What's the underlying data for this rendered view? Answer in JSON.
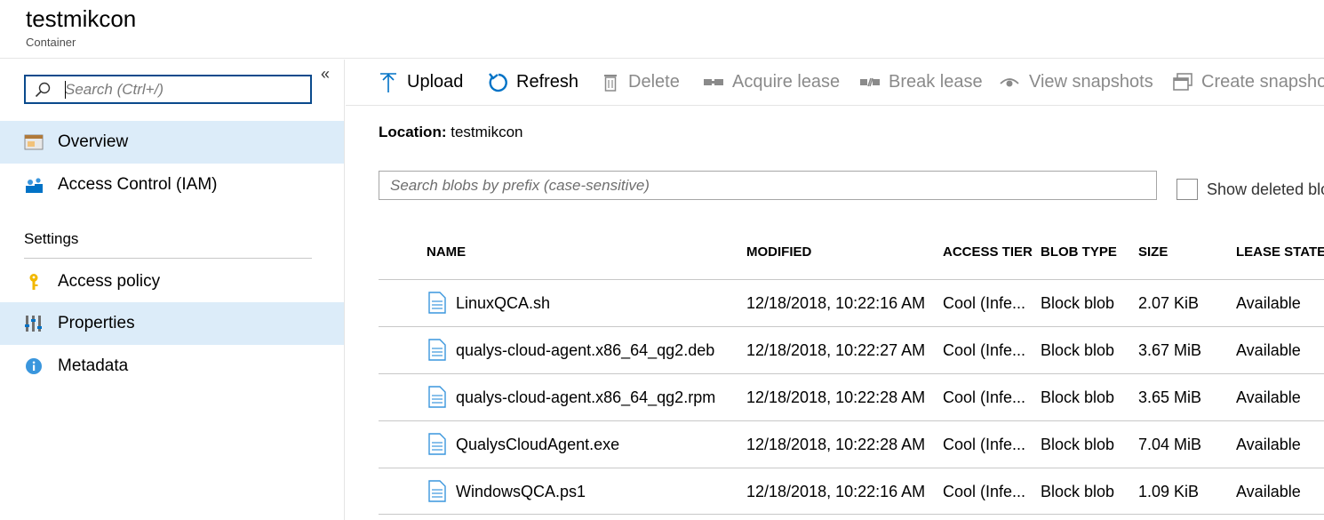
{
  "header": {
    "title": "testmikcon",
    "subtitle": "Container"
  },
  "sidebar": {
    "search_placeholder": "Search (Ctrl+/)",
    "collapse_glyph": "«",
    "items": [
      {
        "label": "Overview",
        "icon": "overview-icon",
        "active": true
      },
      {
        "label": "Access Control (IAM)",
        "icon": "iam-icon",
        "active": false
      }
    ],
    "settings_title": "Settings",
    "settings_items": [
      {
        "label": "Access policy",
        "icon": "key-icon",
        "active": false
      },
      {
        "label": "Properties",
        "icon": "properties-icon",
        "active": true
      },
      {
        "label": "Metadata",
        "icon": "info-icon",
        "active": false
      }
    ]
  },
  "toolbar": {
    "upload": "Upload",
    "refresh": "Refresh",
    "delete": "Delete",
    "acquire_lease": "Acquire lease",
    "break_lease": "Break lease",
    "view_snapshots": "View snapshots",
    "create_snapshot": "Create snapshot"
  },
  "location": {
    "label": "Location:",
    "value": "testmikcon"
  },
  "blob_search": {
    "placeholder": "Search blobs by prefix (case-sensitive)"
  },
  "show_deleted": {
    "label": "Show deleted blobs",
    "checked": false
  },
  "table": {
    "columns": [
      "NAME",
      "MODIFIED",
      "ACCESS TIER",
      "BLOB TYPE",
      "SIZE",
      "LEASE STATE"
    ],
    "rows": [
      {
        "name": "LinuxQCA.sh",
        "modified": "12/18/2018, 10:22:16 AM",
        "tier": "Cool (Infe...",
        "type": "Block blob",
        "size": "2.07 KiB",
        "lease": "Available"
      },
      {
        "name": "qualys-cloud-agent.x86_64_qg2.deb",
        "modified": "12/18/2018, 10:22:27 AM",
        "tier": "Cool (Infe...",
        "type": "Block blob",
        "size": "3.67 MiB",
        "lease": "Available"
      },
      {
        "name": "qualys-cloud-agent.x86_64_qg2.rpm",
        "modified": "12/18/2018, 10:22:28 AM",
        "tier": "Cool (Infe...",
        "type": "Block blob",
        "size": "3.65 MiB",
        "lease": "Available"
      },
      {
        "name": "QualysCloudAgent.exe",
        "modified": "12/18/2018, 10:22:28 AM",
        "tier": "Cool (Infe...",
        "type": "Block blob",
        "size": "7.04 MiB",
        "lease": "Available"
      },
      {
        "name": "WindowsQCA.ps1",
        "modified": "12/18/2018, 10:22:16 AM",
        "tier": "Cool (Infe...",
        "type": "Block blob",
        "size": "1.09 KiB",
        "lease": "Available"
      }
    ]
  },
  "colors": {
    "accent": "#0072c6",
    "active_bg": "#dcecf9",
    "disabled": "#8a8a8a"
  }
}
